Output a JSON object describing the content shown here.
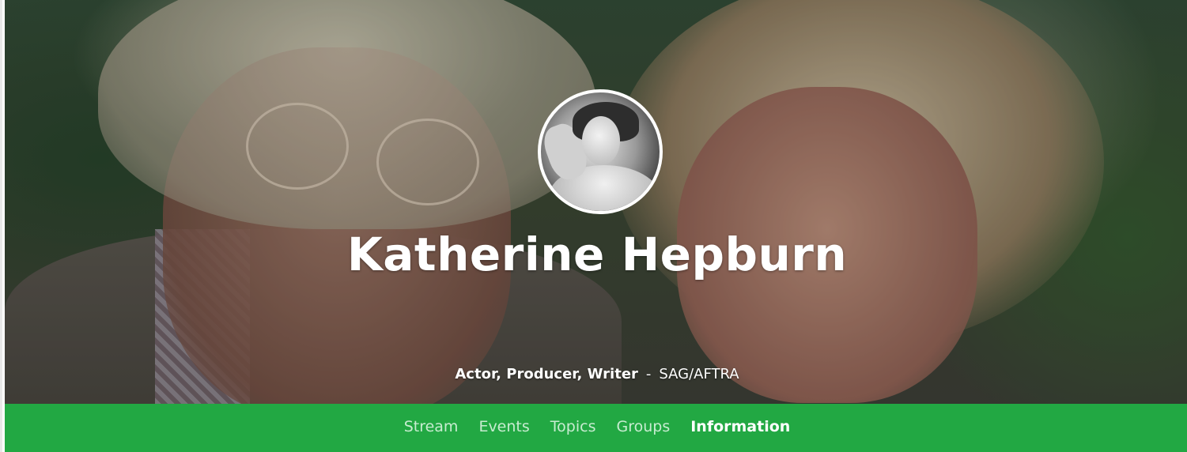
{
  "profile": {
    "name": "Katherine Hepburn",
    "roles": "Actor, Producer, Writer",
    "separator": "-",
    "union": "SAG/AFTRA"
  },
  "nav": {
    "items": [
      {
        "label": "Stream",
        "active": false
      },
      {
        "label": "Events",
        "active": false
      },
      {
        "label": "Topics",
        "active": false
      },
      {
        "label": "Groups",
        "active": false
      },
      {
        "label": "Information",
        "active": true
      }
    ]
  },
  "colors": {
    "nav_background": "#22a843",
    "nav_text": "#c7ecd0",
    "nav_active_text": "#ffffff"
  }
}
